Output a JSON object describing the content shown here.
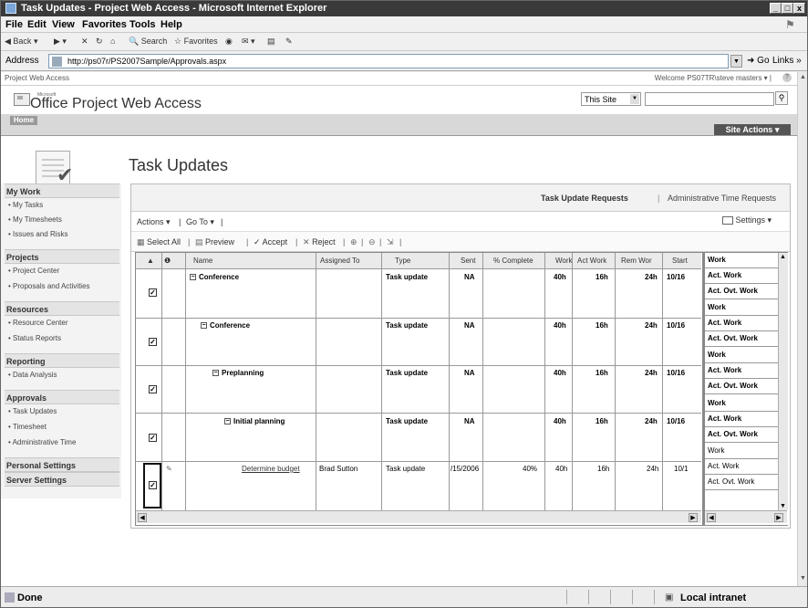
{
  "window": {
    "title": "Task Updates - Project Web Access - Microsoft Internet Explorer",
    "controls": [
      "_",
      "□",
      "x"
    ]
  },
  "menu": [
    "File",
    "Edit",
    "View",
    "Favorites",
    "Tools",
    "Help"
  ],
  "toolbar": {
    "back": "Back",
    "search": "Search",
    "favorites": "Favorites"
  },
  "address": {
    "label": "Address",
    "url": "http://ps07r/PS2007Sample/Approvals.aspx",
    "go": "Go",
    "links": "Links"
  },
  "pwa": {
    "site_label": "Project Web Access",
    "welcome": "Welcome PS07TR\\steve masters ▾ |",
    "brand_small": "Microsoft",
    "brand": "Office Project Web Access",
    "scope": "This Site",
    "home_tab": "Home",
    "site_actions": "Site Actions ▾",
    "page_title": "Task Updates"
  },
  "leftnav": {
    "sections": [
      {
        "title": "My Work",
        "items": [
          "My Tasks",
          "My Timesheets",
          "Issues and Risks"
        ]
      },
      {
        "title": "Projects",
        "items": [
          "Project Center",
          "Proposals and Activities"
        ]
      },
      {
        "title": "Resources",
        "items": [
          "Resource Center",
          "Status Reports"
        ]
      },
      {
        "title": "Reporting",
        "items": [
          "Data Analysis"
        ]
      },
      {
        "title": "Approvals",
        "items": [
          "Task Updates",
          "Timesheet",
          "Administrative Time"
        ]
      },
      {
        "title": "Personal Settings",
        "items": []
      },
      {
        "title": "Server Settings",
        "items": []
      }
    ]
  },
  "tabs": {
    "task_update_requests": "Task Update Requests",
    "separator": "|",
    "admin_time_requests": "Administrative Time Requests"
  },
  "actions": {
    "actions": "Actions ▾",
    "goto": "Go To ▾",
    "settings": "Settings ▾"
  },
  "commands": {
    "select_all": "Select All",
    "preview": "Preview",
    "accept": "Accept",
    "reject": "Reject"
  },
  "grid": {
    "columns": [
      "Name",
      "Assigned To",
      "Type",
      "Sent",
      "% Complete",
      "Work",
      "Act Work",
      "Rem Wor",
      "Start"
    ],
    "rows": [
      {
        "name": "Conference",
        "assigned": "",
        "type": "Task update",
        "sent": "NA",
        "pct": "",
        "work": "40h",
        "act": "16h",
        "rem": "24h",
        "start": "10/16",
        "checked": "✓",
        "bold": true
      },
      {
        "name": "Conference",
        "assigned": "",
        "type": "Task update",
        "sent": "NA",
        "pct": "",
        "work": "40h",
        "act": "16h",
        "rem": "24h",
        "start": "10/16",
        "checked": "✓",
        "bold": true
      },
      {
        "name": "Preplanning",
        "assigned": "",
        "type": "Task update",
        "sent": "NA",
        "pct": "",
        "work": "40h",
        "act": "16h",
        "rem": "24h",
        "start": "10/16",
        "checked": "✓",
        "bold": true
      },
      {
        "name": "Initial planning",
        "assigned": "",
        "type": "Task update",
        "sent": "NA",
        "pct": "",
        "work": "40h",
        "act": "16h",
        "rem": "24h",
        "start": "10/16",
        "checked": "✓",
        "bold": true
      },
      {
        "name": "Determine budget",
        "assigned": "Brad Sutton",
        "type": "Task update",
        "sent": "/15/2006",
        "pct": "40%",
        "work": "40h",
        "act": "16h",
        "rem": "24h",
        "start": "10/1",
        "checked": "✓",
        "bold": false
      }
    ],
    "right_labels": [
      "Work",
      "Act. Work",
      "Act. Ovt. Work"
    ]
  },
  "status": {
    "done": "Done",
    "zone": "Local intranet"
  }
}
